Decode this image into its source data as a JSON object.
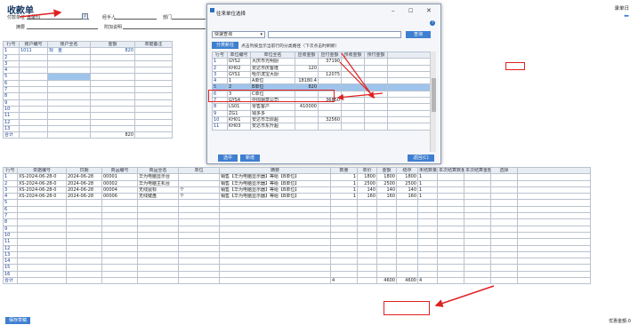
{
  "page": {
    "title": "收款单",
    "top_link": "录单日"
  },
  "form": {
    "customer_label": "付款单位",
    "customer_value": "B单位",
    "handler_label": "经手人",
    "dept_label": "部门",
    "summary_label": "摘要",
    "attach_label": "附加说明"
  },
  "acct_table": {
    "headers": [
      "行号",
      "账户编号",
      "账户全名",
      "金额",
      "单据备注"
    ],
    "rows": [
      {
        "no": "1",
        "code": "1011",
        "name": "现　金",
        "amount": "820"
      }
    ],
    "row_numbers": [
      "1",
      "2",
      "3",
      "4",
      "5",
      "6",
      "7",
      "8",
      "9",
      "10",
      "11",
      "12",
      "13"
    ],
    "total_label": "合计",
    "total_amount": "820"
  },
  "dialog": {
    "title": "往来单位选择",
    "search_mode": "快速查询",
    "search_button": "查询",
    "tab_label": "分类新任",
    "hint": "点击列按显示当前行的分类路径（下次点击时刷新）",
    "headers": [
      "行号",
      "单位编号",
      "单位全名",
      "应收金额",
      "应付金额",
      "预收金额",
      "预付金额"
    ],
    "rows": [
      {
        "no": "1",
        "code": "GYS2",
        "name": "大庆市光明厨",
        "recv": "",
        "pay": "37190"
      },
      {
        "no": "2",
        "code": "KH02",
        "name": "安达市庆客隆",
        "recv": "120",
        "pay": ""
      },
      {
        "no": "3",
        "code": "GYS1",
        "name": "哈尔滨宝大厨",
        "recv": "",
        "pay": "12075"
      },
      {
        "no": "4",
        "code": "1",
        "name": "A单位",
        "recv": "18180.4",
        "pay": ""
      },
      {
        "no": "5",
        "code": "2",
        "name": "B单位",
        "recv": "820",
        "pay": ""
      },
      {
        "no": "6",
        "code": "3",
        "name": "C单位",
        "recv": "",
        "pay": ""
      },
      {
        "no": "7",
        "code": "GYS4",
        "name": "中国烟草公司",
        "recv": "",
        "pay": "36850"
      },
      {
        "no": "8",
        "code": "LS01",
        "name": "零售客户",
        "recv": "410000",
        "pay": ""
      },
      {
        "no": "9",
        "code": "ZG1",
        "name": "钱多多",
        "recv": "",
        "pay": ""
      },
      {
        "no": "10",
        "code": "KH01",
        "name": "安达市华辰超",
        "recv": "",
        "pay": "32560"
      },
      {
        "no": "11",
        "code": "KH03",
        "name": "安达市东升超",
        "recv": "",
        "pay": ""
      }
    ],
    "select_button": "选中",
    "new_button": "新增",
    "back_button": "返回(C)"
  },
  "bill_table": {
    "headers": [
      "行号",
      "单据编号",
      "日期",
      "商品编号",
      "商品全名",
      "单位",
      "摘要",
      "数量",
      "单价",
      "金额",
      "结存",
      "未结数量",
      "本次结算数量",
      "本次结算金额",
      "选择"
    ],
    "rows": [
      {
        "no": "1",
        "billno": "XS-2024-06-28-0",
        "date": "2024-06-28",
        "pcode": "00001",
        "pname": "华为电脑显示台",
        "unit": "",
        "summary": "销售【华为电脑显示器】等给【B单位】",
        "qty": "1",
        "price": "1800",
        "amount": "1800",
        "left": "1800",
        "open": "1"
      },
      {
        "no": "2",
        "billno": "XS-2024-06-28-0",
        "date": "2024-06-28",
        "pcode": "00002",
        "pname": "华为电脑主机台",
        "unit": "",
        "summary": "销售【华为电脑显示器】等给【B单位】",
        "qty": "1",
        "price": "2500",
        "amount": "2500",
        "left": "2500",
        "open": "1"
      },
      {
        "no": "3",
        "billno": "XS-2024-06-28-0",
        "date": "2024-06-28",
        "pcode": "00004",
        "pname": "无线鼠标",
        "unit": "个",
        "summary": "销售【华为电脑显示器】等给【B单位】",
        "qty": "1",
        "price": "140",
        "amount": "140",
        "left": "140",
        "open": "1"
      },
      {
        "no": "4",
        "billno": "XS-2024-06-28-0",
        "date": "2024-06-28",
        "pcode": "00006",
        "pname": "无线键盘",
        "unit": "个",
        "summary": "销售【华为电脑显示器】等给【B单位】",
        "qty": "1",
        "price": "160",
        "amount": "160",
        "left": "160",
        "open": "1"
      }
    ],
    "row_numbers": [
      "1",
      "2",
      "3",
      "4",
      "5",
      "6",
      "7",
      "8",
      "9",
      "10",
      "11",
      "12",
      "13",
      "14",
      "15",
      "16"
    ],
    "total_label": "合计",
    "total_qty": "4",
    "total_amount": "4600",
    "total_left": "4600",
    "total_open": "4"
  },
  "status": {
    "left_button": "保存草稿",
    "right_text": "优惠金额:0"
  }
}
